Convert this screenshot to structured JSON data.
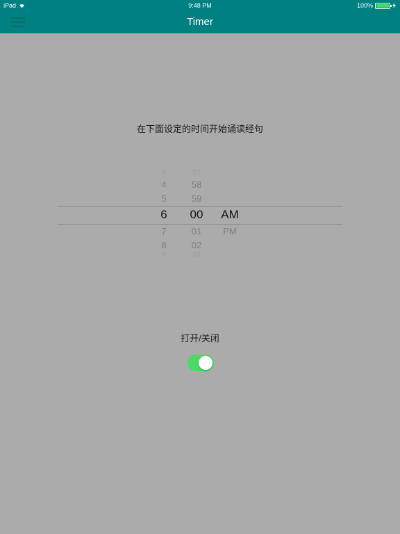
{
  "status_bar": {
    "device": "iPad",
    "time": "9:48 PM",
    "battery": "100%",
    "wifi_icon": "wifi-icon",
    "battery_icon": "battery-icon",
    "charging_icon": "bolt-icon"
  },
  "nav": {
    "title": "Timer",
    "menu_icon": "hamburger-menu-icon"
  },
  "prompt": "在下面设定的时间开始诵读经句",
  "picker": {
    "hours": [
      "3",
      "4",
      "5",
      "6",
      "7",
      "8",
      "9"
    ],
    "minutes": [
      "57",
      "58",
      "59",
      "00",
      "01",
      "02",
      "03"
    ],
    "periods": [
      "AM",
      "PM"
    ],
    "selected": {
      "hour": "6",
      "minute": "00",
      "period": "AM"
    }
  },
  "toggle": {
    "label": "打开/关闭",
    "on": true,
    "on_color": "#4cd964"
  },
  "colors": {
    "bar": "#008080",
    "background": "#ababab"
  }
}
